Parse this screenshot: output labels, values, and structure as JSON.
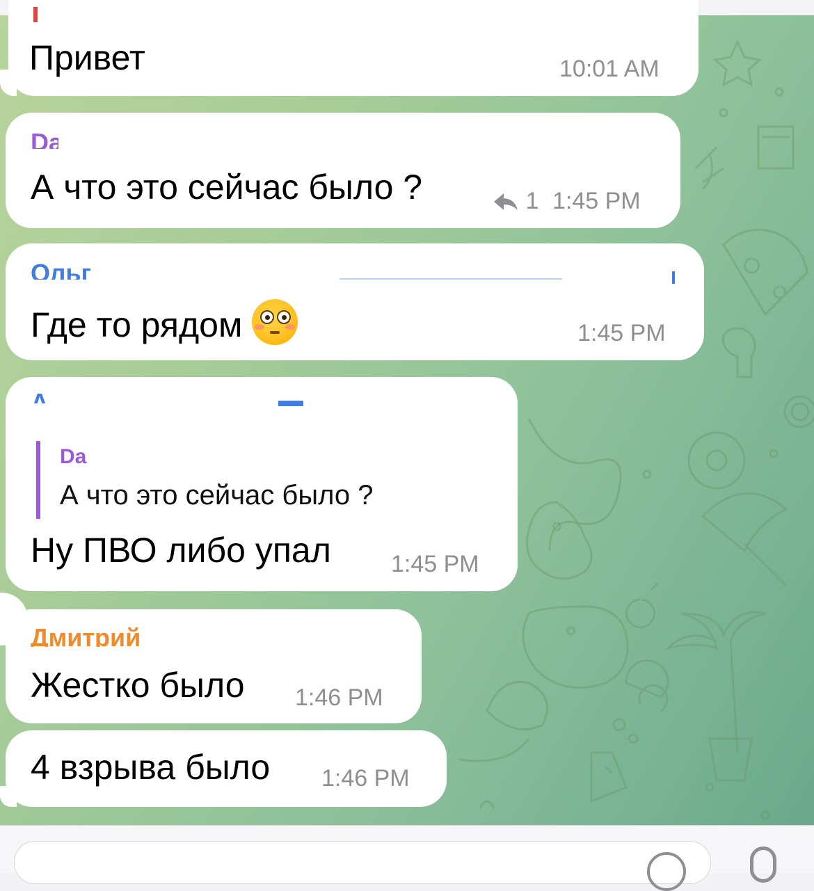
{
  "messages": [
    {
      "id": "m1",
      "sender": "",
      "text": "Привет",
      "time": "10:01 AM"
    },
    {
      "id": "m2",
      "sender": "Da",
      "text": "А что это сейчас было ?",
      "reply_count": "1",
      "time": "1:45 PM"
    },
    {
      "id": "m3",
      "sender": "Ольга",
      "text": "Где то рядом",
      "emoji": "flushed-face",
      "time": "1:45 PM"
    },
    {
      "id": "m4",
      "sender": "А",
      "reply": {
        "sender": "Da",
        "text": "А что это сейчас было ?"
      },
      "text": "Ну ПВО либо упал",
      "time": "1:45 PM"
    },
    {
      "id": "m5",
      "sender": "Дмитрий",
      "text": "Жестко было",
      "time": "1:46 PM"
    },
    {
      "id": "m6",
      "sender": "",
      "text": "4 взрыва было",
      "time": "1:46 PM"
    }
  ],
  "colors": {
    "sender_purple": "#9b5ad6",
    "sender_blue": "#3f7ee0",
    "sender_orange": "#f08a2a",
    "time_gray": "#8e8e93",
    "bubble": "#ffffff"
  },
  "input": {
    "placeholder": ""
  }
}
